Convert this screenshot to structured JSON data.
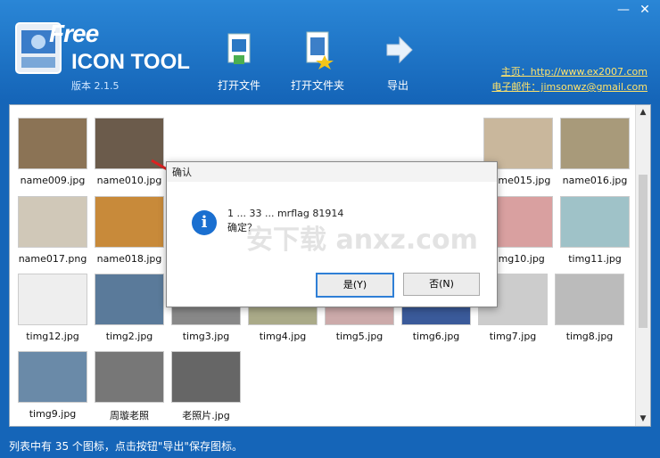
{
  "window": {
    "minimize_label": "—",
    "close_label": "✕"
  },
  "logo": {
    "free_text": "Free",
    "tool_text": "ICON TOOL",
    "version_label": "版本 2.1.5"
  },
  "toolbar": {
    "open_file_label": "打开文件",
    "open_folder_label": "打开文件夹",
    "export_label": "导出"
  },
  "links": {
    "homepage": "主页：http://www.ex2007.com",
    "email": "电子邮件：jimsonwz@gmail.com"
  },
  "thumbnails": [
    {
      "caption": "name009.jpg"
    },
    {
      "caption": "name010.jpg"
    },
    {
      "caption": "name015.jpg"
    },
    {
      "caption": "name016.jpg"
    },
    {
      "caption": "name017.png"
    },
    {
      "caption": "name018.jpg"
    },
    {
      "caption": "timg10.jpg"
    },
    {
      "caption": "timg11.jpg"
    },
    {
      "caption": "timg12.jpg"
    },
    {
      "caption": "timg2.jpg"
    },
    {
      "caption": "timg3.jpg"
    },
    {
      "caption": "timg4.jpg"
    },
    {
      "caption": "timg5.jpg"
    },
    {
      "caption": "timg6.jpg"
    },
    {
      "caption": "timg7.jpg"
    },
    {
      "caption": "timg8.jpg"
    },
    {
      "caption": "timg9.jpg"
    },
    {
      "caption": "周璇老照"
    },
    {
      "caption": "老照片.jpg"
    }
  ],
  "dialog": {
    "title": "确认",
    "message": "1 ... 33 ... mrflag 81914",
    "message2": "确定？",
    "yes_label": "是(Y)",
    "no_label": "否(N)"
  },
  "watermark": "安下载 anxz.com",
  "status": "列表中有 35 个图标，点击按钮\"导出\"保存图标。"
}
